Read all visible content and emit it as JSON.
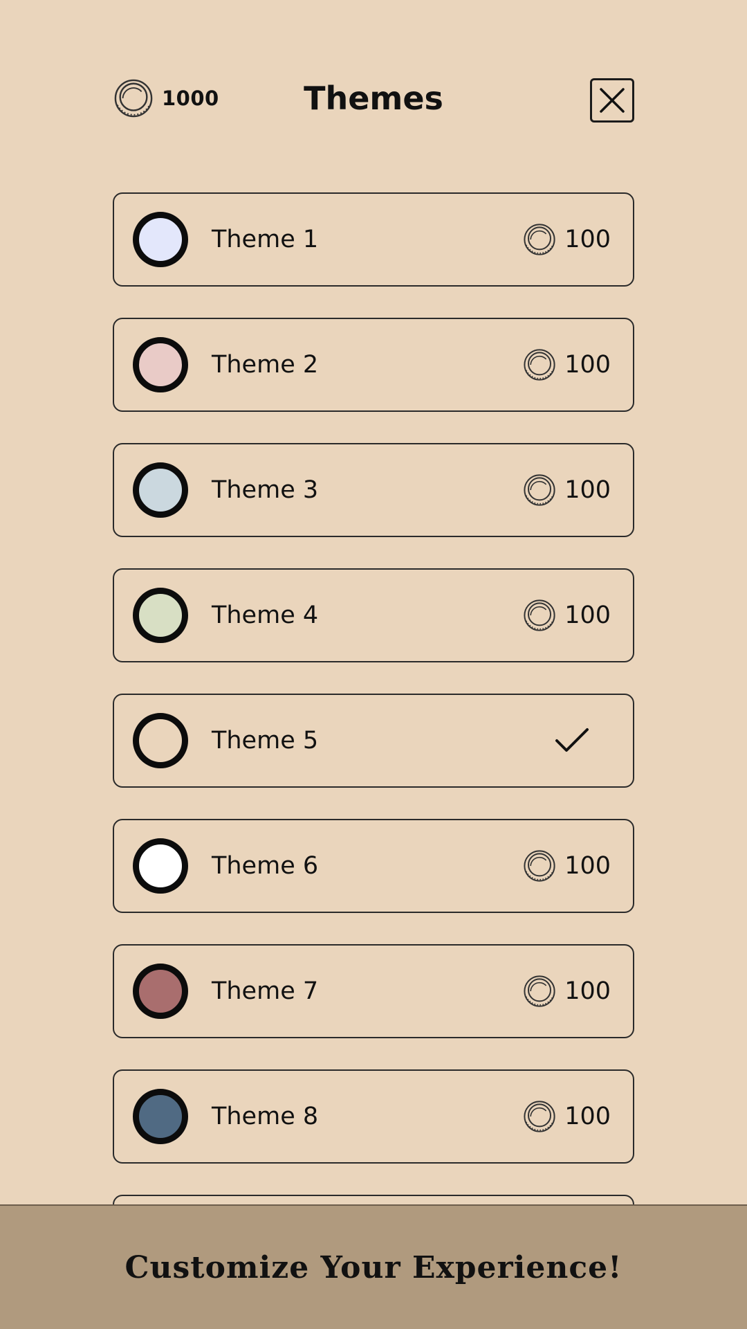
{
  "header": {
    "balance": "1000",
    "title": "Themes",
    "close_icon": "close-icon",
    "coin_icon": "coin-icon"
  },
  "themes": [
    {
      "label": "Theme 1",
      "color": "#e3e7fb",
      "price": "100",
      "owned": false
    },
    {
      "label": "Theme 2",
      "color": "#e9cbc7",
      "price": "100",
      "owned": false
    },
    {
      "label": "Theme 3",
      "color": "#cbd8df",
      "price": "100",
      "owned": false
    },
    {
      "label": "Theme 4",
      "color": "#d8dfc4",
      "price": "100",
      "owned": false
    },
    {
      "label": "Theme 5",
      "color": "#ead5bc",
      "price": "",
      "owned": true
    },
    {
      "label": "Theme 6",
      "color": "#ffffff",
      "price": "100",
      "owned": false
    },
    {
      "label": "Theme 7",
      "color": "#a96e6e",
      "price": "100",
      "owned": false
    },
    {
      "label": "Theme 8",
      "color": "#506a83",
      "price": "100",
      "owned": false
    }
  ],
  "footer": {
    "text": "Customize Your Experience!"
  },
  "colors": {
    "background": "#ead5bc",
    "footer": "#b09a7e"
  }
}
